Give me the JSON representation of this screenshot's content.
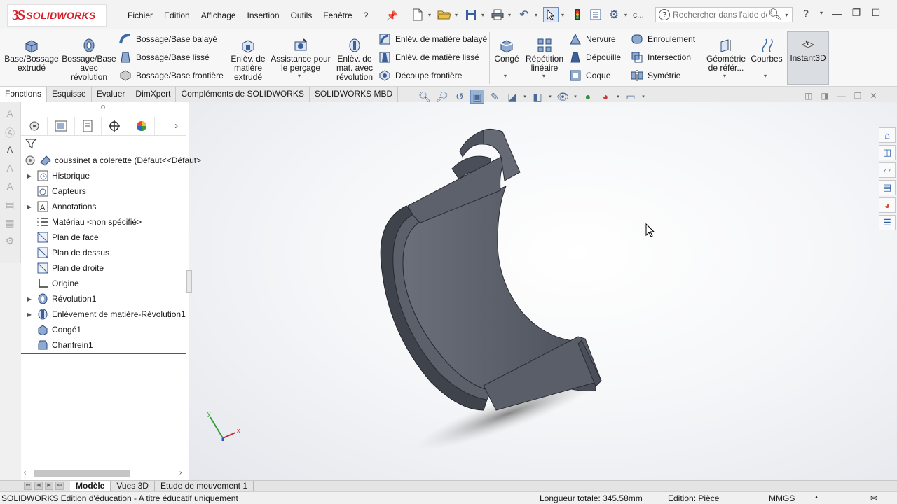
{
  "app": {
    "brand_ds": "3S",
    "brand_name": "SOLIDWORKS"
  },
  "menu": [
    "Fichier",
    "Edition",
    "Affichage",
    "Insertion",
    "Outils",
    "Fenêtre",
    "?"
  ],
  "quick_access": {
    "truncated_label": "c...",
    "search_placeholder": "Rechercher dans l'aide de"
  },
  "ribbon": {
    "extrude": "Base/Bossage extrudé",
    "revolve": "Bossage/Base avec révolution",
    "sweep": "Bossage/Base balayé",
    "loft": "Bossage/Base lissé",
    "boundary": "Bossage/Base frontière",
    "cut_extrude": "Enlèv. de matière extrudé",
    "hole_wizard": "Assistance pour le perçage",
    "cut_revolve": "Enlèv. de mat. avec révolution",
    "cut_sweep": "Enlèv. de matière balayé",
    "cut_loft": "Enlèv. de matière lissé",
    "boundary_cut": "Découpe frontière",
    "fillet": "Congé",
    "pattern": "Répétition linéaire",
    "rib": "Nervure",
    "draft": "Dépouille",
    "shell": "Coque",
    "wrap": "Enroulement",
    "intersect": "Intersection",
    "mirror": "Symétrie",
    "ref_geom": "Géométrie de référ...",
    "curves": "Courbes",
    "instant3d": "Instant3D"
  },
  "cm_tabs": [
    "Fonctions",
    "Esquisse",
    "Evaluer",
    "DimXpert",
    "Compléments de SOLIDWORKS",
    "SOLIDWORKS MBD"
  ],
  "feature_tree": {
    "root": "coussinet a colerette  (Défaut<<Défaut>",
    "items": [
      {
        "label": "Historique",
        "icon": "history-icon",
        "expandable": true
      },
      {
        "label": "Capteurs",
        "icon": "sensor-icon",
        "expandable": false
      },
      {
        "label": "Annotations",
        "icon": "annotation-icon",
        "expandable": true
      },
      {
        "label": "Matériau <non spécifié>",
        "icon": "material-icon",
        "expandable": false
      },
      {
        "label": "Plan de face",
        "icon": "plane-icon",
        "expandable": false
      },
      {
        "label": "Plan de dessus",
        "icon": "plane-icon",
        "expandable": false
      },
      {
        "label": "Plan de droite",
        "icon": "plane-icon",
        "expandable": false
      },
      {
        "label": "Origine",
        "icon": "origin-icon",
        "expandable": false
      },
      {
        "label": "Révolution1",
        "icon": "revolve-feature-icon",
        "expandable": true
      },
      {
        "label": "Enlèvement de matière-Révolution1",
        "icon": "cut-revolve-feature-icon",
        "expandable": true
      },
      {
        "label": "Congé1",
        "icon": "fillet-feature-icon",
        "expandable": false
      },
      {
        "label": "Chanfrein1",
        "icon": "chamfer-feature-icon",
        "expandable": false
      }
    ]
  },
  "bottom_tabs": [
    "Modèle",
    "Vues 3D",
    "Etude de mouvement 1"
  ],
  "status": {
    "edition": "SOLIDWORKS Edition d'éducation - A titre éducatif uniquement",
    "length": "Longueur totale: 345.58mm",
    "mode": "Edition: Pièce",
    "units": "MMGS"
  },
  "triad": {
    "x_label": "x",
    "y_label": "y"
  },
  "colors": {
    "brand_red": "#d8202a",
    "part_gray": "#5a5e68",
    "selection_blue": "#2a5fa8"
  }
}
